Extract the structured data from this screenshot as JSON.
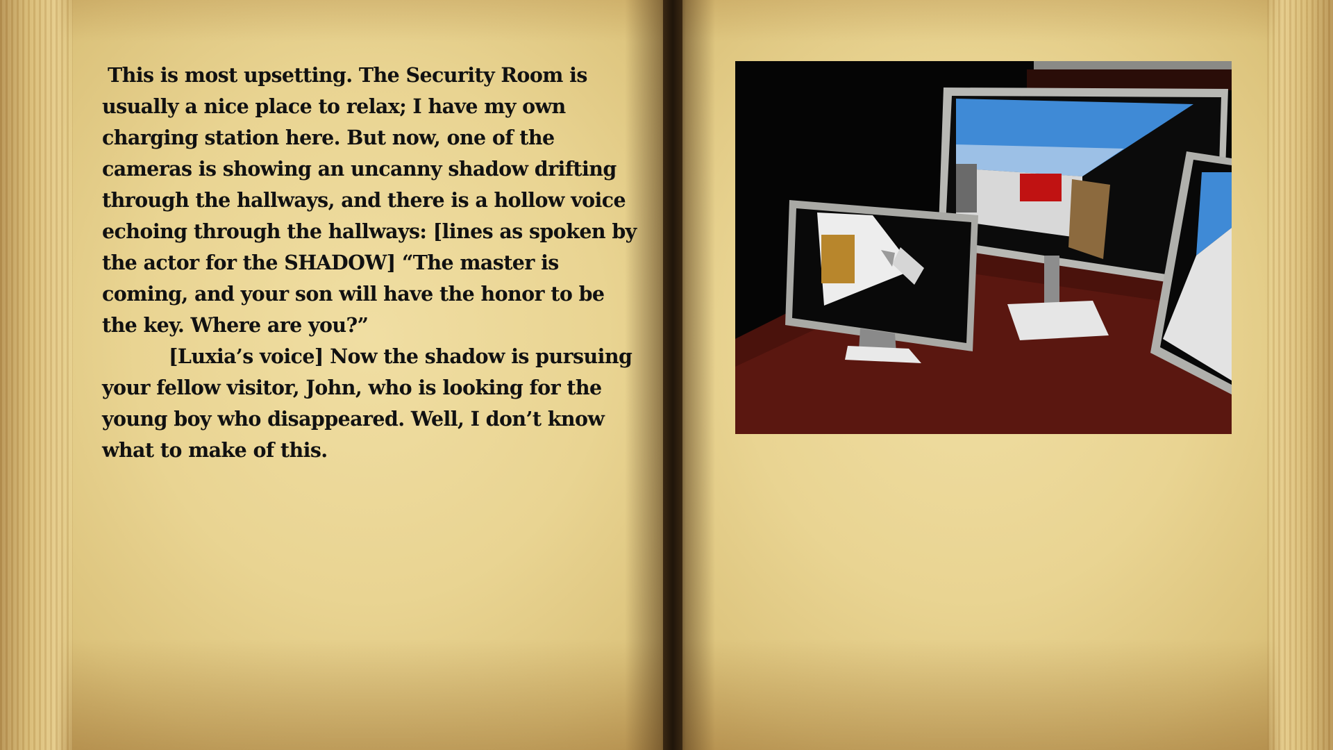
{
  "book": {
    "left_page": {
      "paragraph_1": "This is most upsetting. The Security Room is usually a nice place to relax; I have my own charging station here. But now, one of the cameras is showing an uncanny shadow drifting through the hallways, and there is a hollow voice echoing through the hallways: [lines as spoken by the actor for the SHADOW] “The master is coming, and your son will have the honor to be the key. Where are you?”",
      "paragraph_2": "[Luxia’s voice] Now the shadow is pursuing your fellow visitor, John, who is looking for the young boy who disappeared. Well, I don’t know what to make of this."
    },
    "right_page": {
      "image_subject": "security-room-monitors"
    }
  },
  "colors": {
    "parchment": "#e9d492",
    "text": "#111111",
    "spine": "#1f150a"
  }
}
